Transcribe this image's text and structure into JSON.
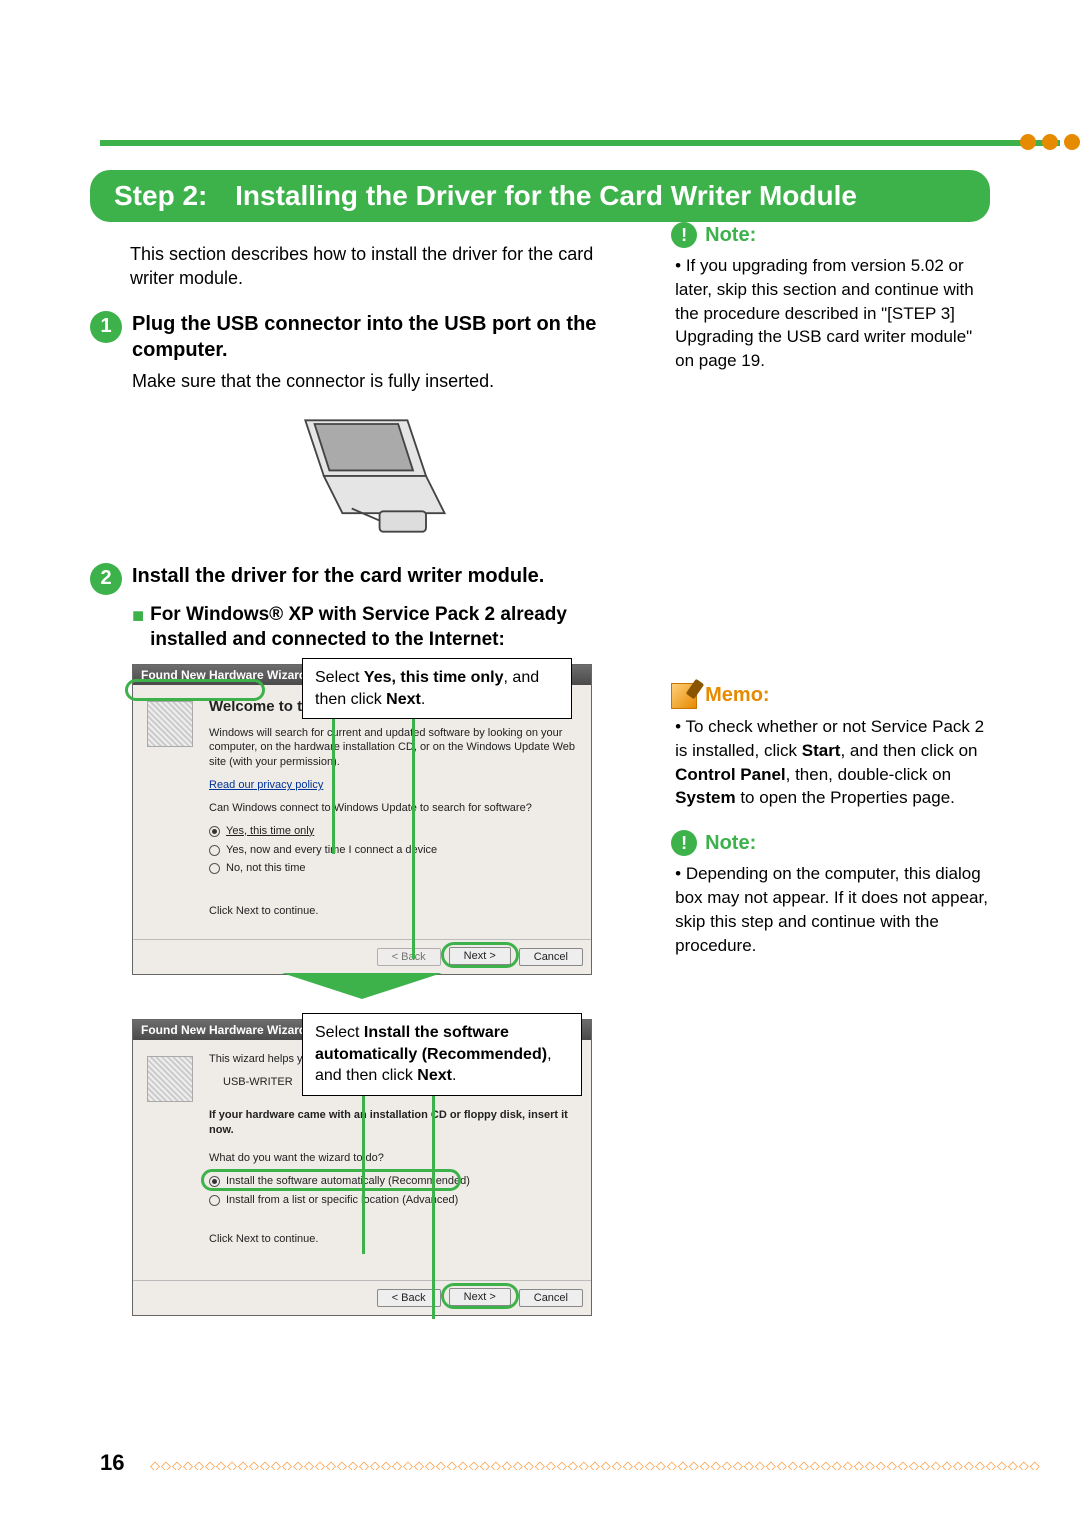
{
  "header": {
    "step_label": "Step 2:",
    "step_title": "Installing the Driver for the Card Writer Module"
  },
  "intro": "This section describes how to install the driver for the card writer module.",
  "steps": {
    "s1": {
      "num": "1",
      "title": "Plug the USB connector into the USB port on the computer.",
      "text": "Make sure that the connector is fully inserted."
    },
    "s2": {
      "num": "2",
      "title": "Install the driver for the card writer module.",
      "sub": "For Windows® XP with Service Pack 2 already installed and connected to the Internet:"
    }
  },
  "callout1_pre": "Select ",
  "callout1_bold": "Yes, this time only",
  "callout1_post": ", and then click ",
  "callout1_bold2": "Next",
  "callout1_end": ".",
  "callout2_pre": "Select ",
  "callout2_bold": "Install the software automatically (Recommended)",
  "callout2_post": ", and then click ",
  "callout2_bold2": "Next",
  "callout2_end": ".",
  "dialog1": {
    "title": "Found New Hardware Wizard",
    "welcome": "Welcome to the Found New Hardware Wizard",
    "p1": "Windows will search for current and updated software by looking on your computer, on the hardware installation CD, or on the Windows Update Web site (with your permission).",
    "privacy": "Read our privacy policy",
    "q": "Can Windows connect to Windows Update to search for software?",
    "r1": "Yes, this time only",
    "r2": "Yes, now and every time I connect a device",
    "r3": "No, not this time",
    "cont": "Click Next to continue.",
    "back": "< Back",
    "next": "Next >",
    "cancel": "Cancel"
  },
  "dialog2": {
    "title": "Found New Hardware Wizard",
    "helps": "This wizard helps you install software for:",
    "device": "USB-WRITER",
    "cd": "If your hardware came with an installation CD or floppy disk, insert it now.",
    "what": "What do you want the wizard to do?",
    "r1": "Install the software automatically (Recommended)",
    "r2": "Install from a list or specific location (Advanced)",
    "cont": "Click Next to continue.",
    "back": "< Back",
    "next": "Next >",
    "cancel": "Cancel"
  },
  "sidebar": {
    "note1_label": "Note:",
    "note1_text": "If you upgrading from version 5.02 or later, skip this section and continue with the procedure described in \"[STEP 3] Upgrading the USB card writer module\" on page 19.",
    "memo_label": "Memo:",
    "memo_pre": "To check whether or not Service Pack 2 is installed, click ",
    "memo_b1": "Start",
    "memo_mid1": ", and then click on ",
    "memo_b2": "Control Panel",
    "memo_mid2": ", then, double-click on ",
    "memo_b3": "System",
    "memo_post": " to open the Properties page.",
    "note2_label": "Note:",
    "note2_text": "Depending on the computer, this dialog box may not appear. If it does not appear, skip this step and continue with the procedure."
  },
  "page_number": "16",
  "deco": "◇◇◇◇◇◇◇◇◇◇◇◇◇◇◇◇◇◇◇◇◇◇◇◇◇◇◇◇◇◇◇◇◇◇◇◇◇◇◇◇◇◇◇◇◇◇◇◇◇◇◇◇◇◇◇◇◇◇◇◇◇◇◇◇◇◇◇◇◇◇◇◇◇◇◇◇◇◇◇◇◇"
}
